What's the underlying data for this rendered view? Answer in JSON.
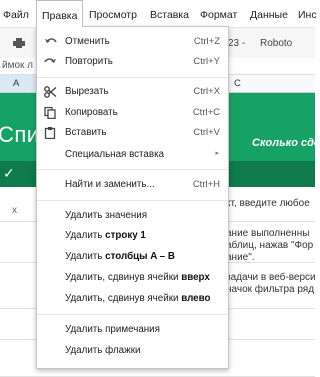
{
  "menubar": {
    "items": [
      {
        "label": "Файл"
      },
      {
        "label": "Правка"
      },
      {
        "label": "Просмотр"
      },
      {
        "label": "Вставка"
      },
      {
        "label": "Формат"
      },
      {
        "label": "Данные"
      },
      {
        "label": "Инс"
      }
    ]
  },
  "toolbar": {
    "zoom_fragment": "23 -",
    "font": "Roboto"
  },
  "formula_fragment": "ймок л",
  "columns": {
    "a": "A",
    "c": "C"
  },
  "sheet": {
    "title_fragment": "Спис",
    "subtitle_fragment": "Сколько сдел",
    "check": "✓",
    "row_marker": "x",
    "input_hint": "кт, введите любое",
    "lines": [
      "ание выполненны",
      "аблиц, нажав \"Фор",
      "ание\".",
      "задачи в веб-верси",
      "начок фильтра ряд"
    ]
  },
  "edit_menu": {
    "undo": {
      "label": "Отменить",
      "shortcut": "Ctrl+Z"
    },
    "redo": {
      "label": "Повторить",
      "shortcut": "Ctrl+Y"
    },
    "cut": {
      "label": "Вырезать",
      "shortcut": "Ctrl+X"
    },
    "copy": {
      "label": "Копировать",
      "shortcut": "Ctrl+C"
    },
    "paste": {
      "label": "Вставить",
      "shortcut": "Ctrl+V"
    },
    "paste_special": {
      "label": "Специальная вставка",
      "arrow": "▸"
    },
    "find_replace": {
      "label": "Найти и заменить...",
      "shortcut": "Ctrl+H"
    },
    "delete_values": {
      "label": "Удалить значения"
    },
    "delete_row": {
      "prefix": "Удалить ",
      "bold": "строку 1"
    },
    "delete_columns": {
      "prefix": "Удалить ",
      "bold": "столбцы A – B"
    },
    "delete_cells_up": {
      "prefix": "Удалить, сдвинув ячейки ",
      "bold": "вверх"
    },
    "delete_cells_left": {
      "prefix": "Удалить, сдвинув ячейки ",
      "bold": "влево"
    },
    "delete_notes": {
      "label": "Удалить примечания"
    },
    "delete_checkboxes": {
      "label": "Удалить флажки"
    }
  }
}
